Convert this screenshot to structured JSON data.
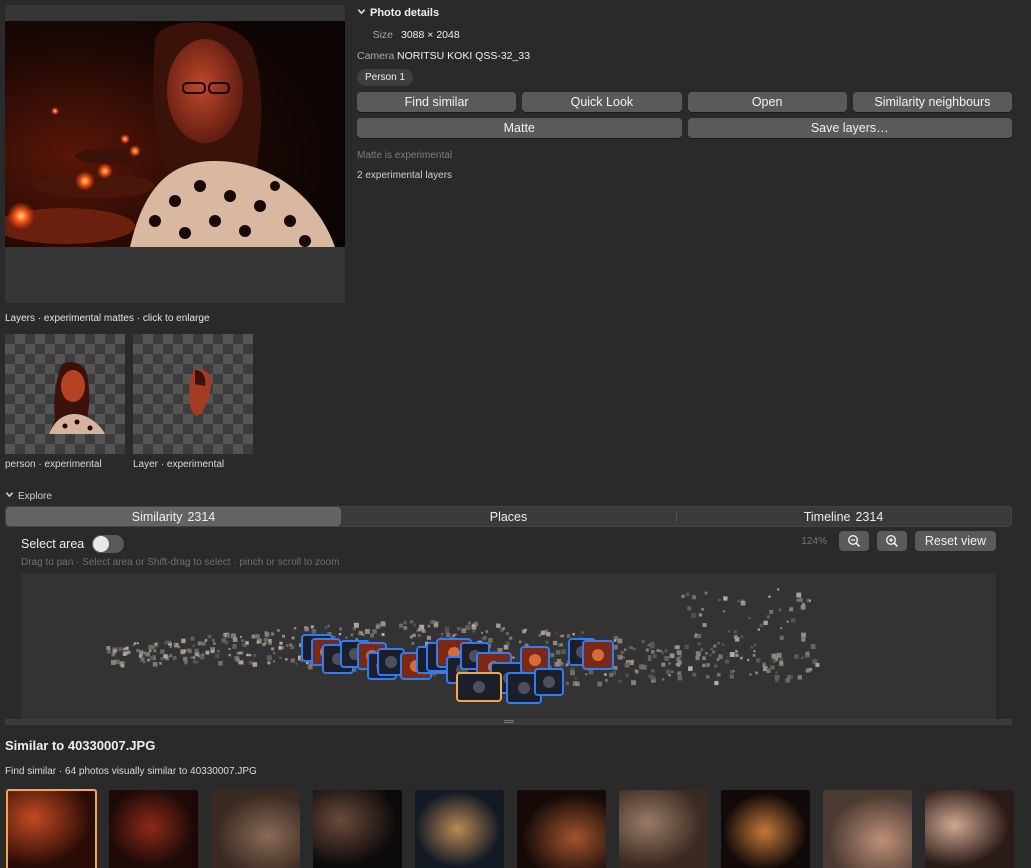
{
  "preview": {
    "image_desc": "woman-in-dark-bar-with-candles"
  },
  "details": {
    "header": "Photo details",
    "size_label": "Size",
    "size_value": "3088 × 2048",
    "camera_label": "Camera",
    "camera_value": "NORITSU KOKI QSS-32_33",
    "person_chip": "Person 1",
    "buttons": {
      "find_similar": "Find similar",
      "quick_look": "Quick Look",
      "open": "Open",
      "similarity_neighbours": "Similarity neighbours",
      "matte": "Matte",
      "save_layers": "Save layers…"
    },
    "matte_note": "Matte is experimental",
    "layers_note": "2 experimental layers"
  },
  "layers": {
    "title": "Layers · experimental mattes · click to enlarge",
    "items": [
      {
        "caption": "person · experimental"
      },
      {
        "caption": "Layer · experimental"
      }
    ]
  },
  "explore": {
    "header": "Explore",
    "tabs": [
      {
        "label": "Similarity",
        "count": "2314"
      },
      {
        "label": "Places",
        "count": ""
      },
      {
        "label": "Timeline",
        "count": "2314"
      }
    ],
    "select_area_label": "Select area",
    "select_area_on": false,
    "zoom_pct": "124%",
    "reset_label": "Reset view",
    "hint": "Drag to pan · Select area or Shift-drag to select · pinch or scroll to zoom"
  },
  "similar": {
    "title": "Similar to 40330007.JPG",
    "subtitle": "Find similar · 64 photos visually similar to 40330007.JPG",
    "count": 10
  },
  "colors": {
    "accent_blue": "#2f7cf6",
    "selected_orange": "#f2a94a",
    "button_bg": "#5a5a5a"
  },
  "icons": {
    "disclosure": "chevron-down-icon",
    "zoom_out": "zoom-out-icon",
    "zoom_in": "zoom-in-icon"
  }
}
